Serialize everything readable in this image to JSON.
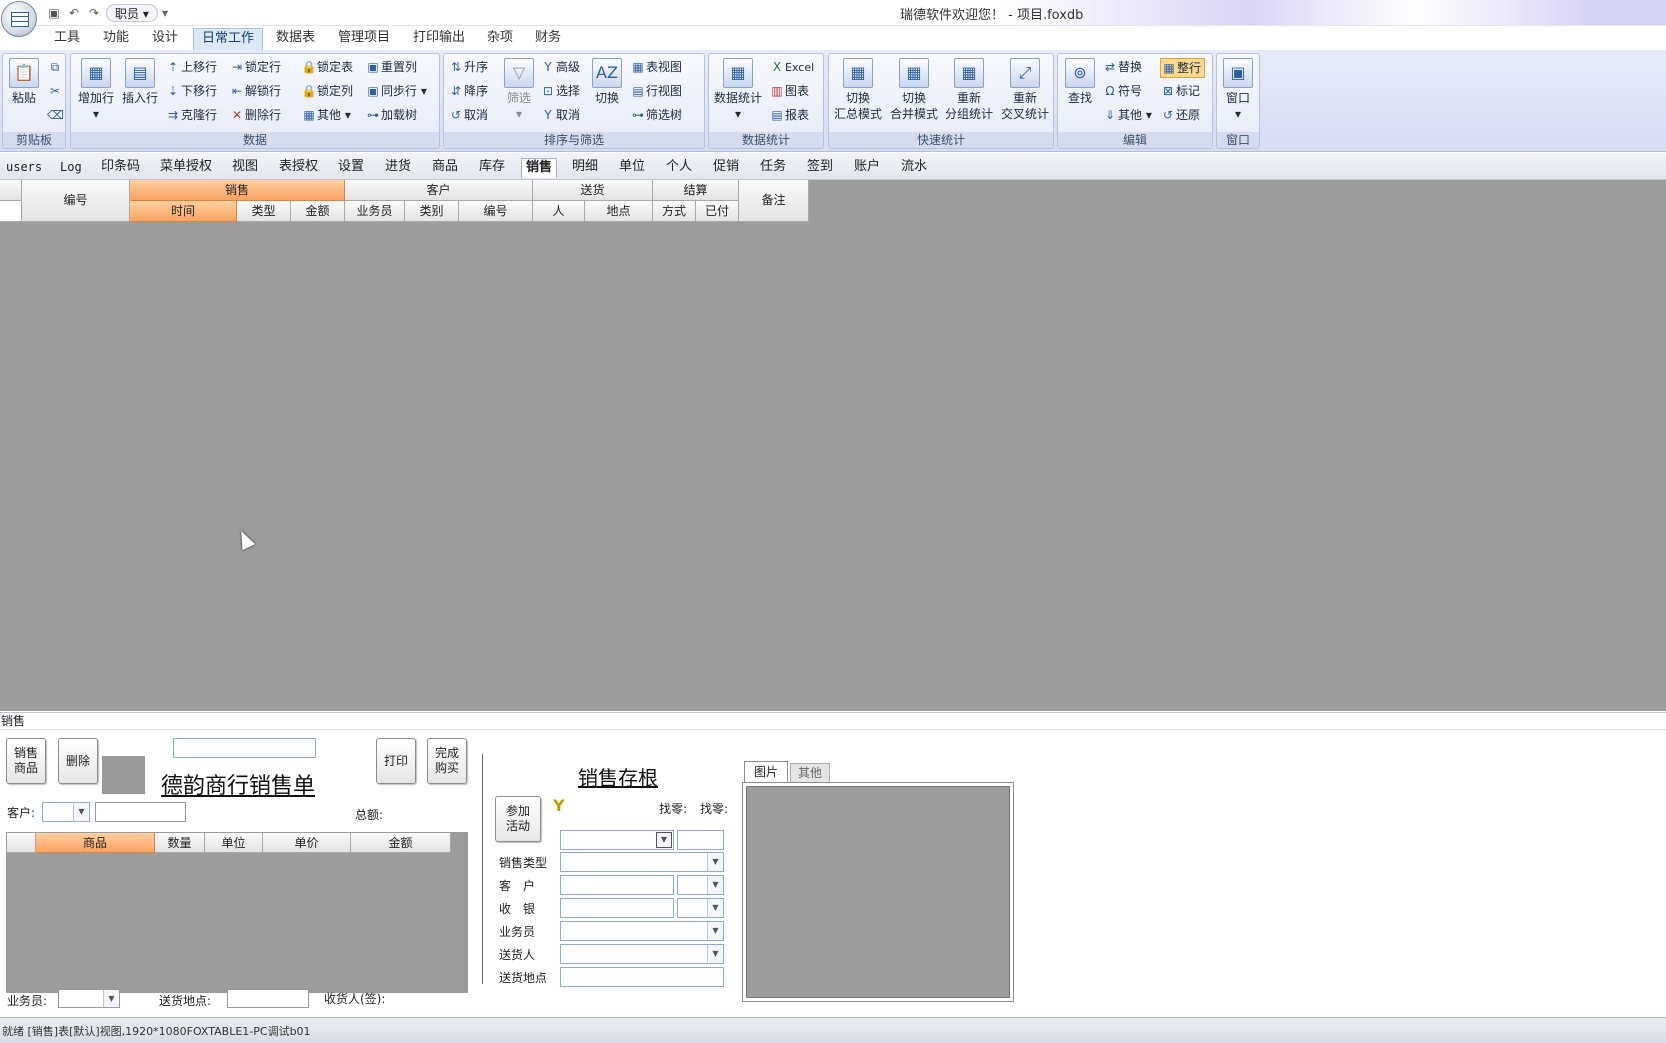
{
  "qat": {
    "role_label": "职员"
  },
  "window_title": "瑞德软件欢迎您！ - 项目.foxdb",
  "ribbon_tabs": [
    "工具",
    "功能",
    "设计",
    "日常工作",
    "数据表",
    "管理项目",
    "打印输出",
    "杂项",
    "财务"
  ],
  "ribbon_active_tab": "日常工作",
  "groups": {
    "clipboard": {
      "label": "剪贴板",
      "paste": "粘贴"
    },
    "data": {
      "label": "数据",
      "add_row": "增加行",
      "insert_row": "插入行",
      "move_up": "上移行",
      "move_down": "下移行",
      "clone_row": "克隆行",
      "lock_row": "锁定行",
      "unlock_row": "解锁行",
      "delete_row": "删除行",
      "lock_table": "锁定表",
      "lock_col": "锁定列",
      "other": "其他",
      "reset_col": "重置列",
      "sync_row": "同步行",
      "load_tree": "加载树"
    },
    "sort": {
      "label": "排序与筛选",
      "asc": "升序",
      "desc": "降序",
      "cancel": "取消",
      "filter": "筛选",
      "advanced": "高级",
      "select": "选择",
      "cancel2": "取消",
      "switch": "切换",
      "table_view": "表视图",
      "row_view": "行视图",
      "filter_tree": "筛选树"
    },
    "stats": {
      "label": "数据统计",
      "data_stats": "数据统计",
      "excel": "Excel",
      "chart": "图表",
      "report": "报表"
    },
    "quick": {
      "label": "快速统计",
      "b1_l1": "切换",
      "b1_l2": "汇总模式",
      "b2_l1": "切换",
      "b2_l2": "合并模式",
      "b3_l1": "重新",
      "b3_l2": "分组统计",
      "b4_l1": "重新",
      "b4_l2": "交叉统计"
    },
    "edit": {
      "label": "编辑",
      "find": "查找",
      "replace": "替换",
      "symbol": "符号",
      "other": "其他",
      "whole_row": "整行",
      "mark": "标记",
      "restore": "还原"
    },
    "window": {
      "label": "窗口",
      "window": "窗口"
    }
  },
  "table_tabs": [
    "users",
    "Log",
    "印条码",
    "菜单授权",
    "视图",
    "表授权",
    "设置",
    "进货",
    "商品",
    "库存",
    "销售",
    "明细",
    "单位",
    "个人",
    "促销",
    "任务",
    "签到",
    "账户",
    "流水"
  ],
  "table_active_tab": "销售",
  "grid_header": {
    "id": "编号",
    "sale": "销售",
    "time": "时间",
    "type": "类型",
    "amount": "金额",
    "customer": "客户",
    "salesman": "业务员",
    "category": "类别",
    "cust_id": "编号",
    "delivery": "送货",
    "person": "人",
    "place": "地点",
    "settle": "结算",
    "method": "方式",
    "paid": "已付",
    "note": "备注"
  },
  "form": {
    "caption": "销售",
    "btn_sell": "销售商品",
    "btn_delete": "删除",
    "btn_print": "打印",
    "btn_finish": "完成购买",
    "receipt_title": "德韵商行销售单",
    "customer_label": "客户:",
    "total_label": "总额:",
    "items_header": {
      "product": "商品",
      "qty": "数量",
      "unit": "单位",
      "price": "单价",
      "amount": "金额"
    },
    "salesman_label": "业务员:",
    "delivery_place_label": "送货地点:",
    "receiver_label": "收货人(签):",
    "stub_title": "销售存根",
    "btn_join": "参加活动",
    "yen_symbol": "Y",
    "change1": "找零:",
    "change2": "找零:",
    "sale_type": "销售类型",
    "customer": "客　户",
    "cashier": "收　银",
    "salesman": "业务员",
    "deliverer": "送货人",
    "delivery_place": "送货地点",
    "tab_picture": "图片",
    "tab_other": "其他"
  },
  "status_text": "就绪 [销售]表[默认]视图,1920*1080FOXTABLE1-PC调试b01"
}
